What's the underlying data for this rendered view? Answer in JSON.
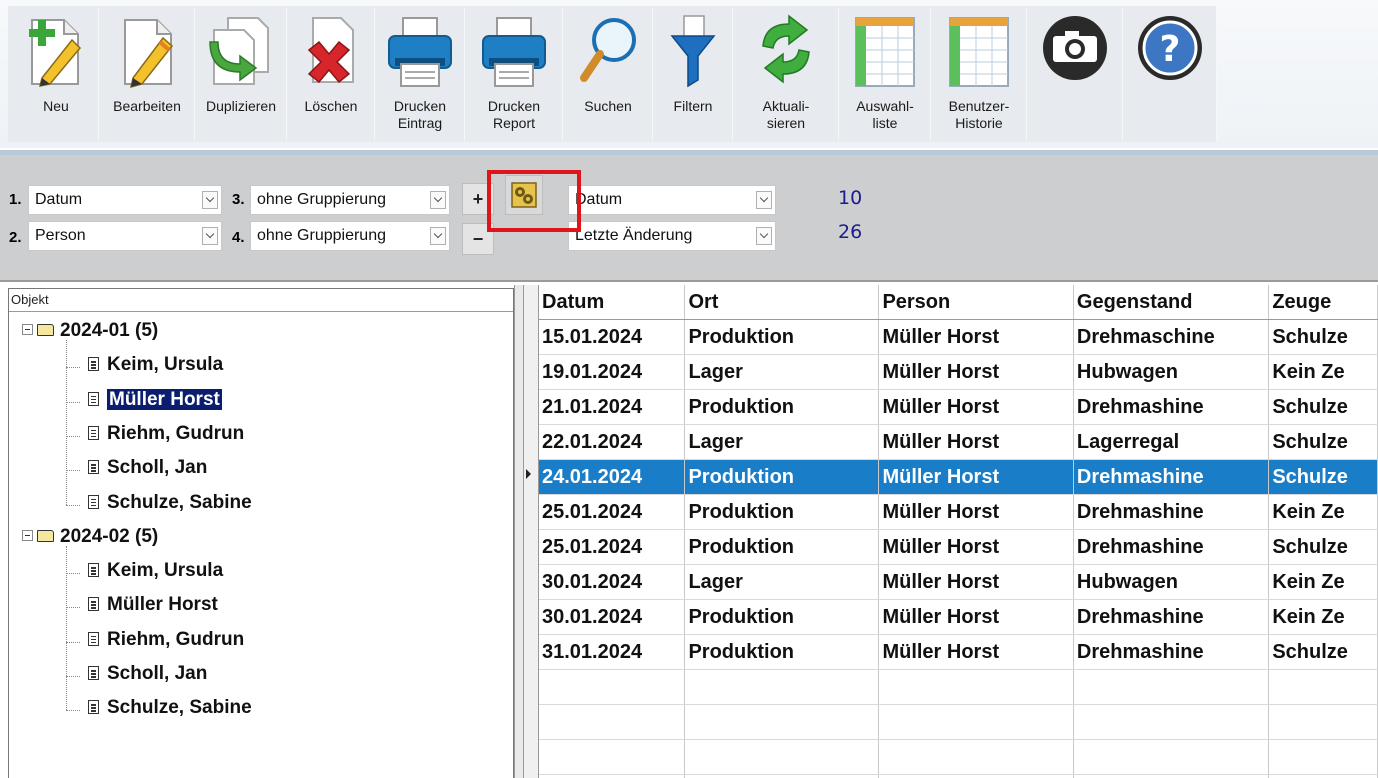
{
  "toolbar": {
    "buttons": [
      {
        "label": "Neu"
      },
      {
        "label": "Bearbeiten"
      },
      {
        "label": "Duplizieren"
      },
      {
        "label": "Löschen"
      },
      {
        "label": "Drucken\nEintrag"
      },
      {
        "label": "Drucken\nReport"
      },
      {
        "label": "Suchen"
      },
      {
        "label": "Filtern"
      },
      {
        "label": "Aktuali-\nsieren"
      },
      {
        "label": "Auswahl-\nliste"
      },
      {
        "label": "Benutzer-\nHistorie"
      },
      {
        "label": ""
      },
      {
        "label": ""
      }
    ],
    "icons": [
      "new-icon",
      "edit-icon",
      "duplicate-icon",
      "delete-icon",
      "print-entry-icon",
      "print-report-icon",
      "search-icon",
      "filter-icon",
      "refresh-icon",
      "selection-list-icon",
      "user-history-icon",
      "camera-icon",
      "help-icon"
    ]
  },
  "grouping": {
    "g1": {
      "num": "1.",
      "value": "Datum"
    },
    "g2": {
      "num": "2.",
      "value": "Person"
    },
    "g3": {
      "num": "3.",
      "value": "ohne Gruppierung"
    },
    "g4": {
      "num": "4.",
      "value": "ohne Gruppierung"
    },
    "plus": "+",
    "minus": "−",
    "sort1": "Datum",
    "sort2": "Letzte Änderung",
    "count1": "10",
    "count2": "26"
  },
  "tree": {
    "header": "Objekt",
    "groups": [
      {
        "label": "2024-01  (5)",
        "items": [
          "Keim, Ursula",
          "Müller Horst",
          "Riehm, Gudrun",
          "Scholl, Jan",
          "Schulze, Sabine"
        ]
      },
      {
        "label": "2024-02  (5)",
        "items": [
          "Keim, Ursula",
          "Müller Horst",
          "Riehm, Gudrun",
          "Scholl, Jan",
          "Schulze, Sabine"
        ]
      }
    ],
    "selected": "Müller Horst"
  },
  "table": {
    "columns": [
      "Datum",
      "Ort",
      "Person",
      "Gegenstand",
      "Zeuge"
    ],
    "rows": [
      [
        "15.01.2024",
        "Produktion",
        "Müller Horst",
        "Drehmaschine",
        "Schulze"
      ],
      [
        "19.01.2024",
        "Lager",
        "Müller Horst",
        "Hubwagen",
        "Kein Ze"
      ],
      [
        "21.01.2024",
        "Produktion",
        "Müller Horst",
        "Drehmashine",
        "Schulze"
      ],
      [
        "22.01.2024",
        "Lager",
        "Müller Horst",
        "Lagerregal",
        "Schulze"
      ],
      [
        "24.01.2024",
        "Produktion",
        "Müller Horst",
        "Drehmashine",
        "Schulze"
      ],
      [
        "25.01.2024",
        "Produktion",
        "Müller Horst",
        "Drehmashine",
        "Kein Ze"
      ],
      [
        "25.01.2024",
        "Produktion",
        "Müller Horst",
        "Drehmashine",
        "Schulze"
      ],
      [
        "30.01.2024",
        "Lager",
        "Müller Horst",
        "Hubwagen",
        "Kein Ze"
      ],
      [
        "30.01.2024",
        "Produktion",
        "Müller Horst",
        "Drehmashine",
        "Kein Ze"
      ],
      [
        "31.01.2024",
        "Produktion",
        "Müller Horst",
        "Drehmashine",
        "Schulze"
      ]
    ],
    "selected_row": 4,
    "colors": {
      "selection": "#1a7dc7",
      "tree_selection": "#0b1d6e",
      "highlight_box": "#e1141b"
    }
  }
}
